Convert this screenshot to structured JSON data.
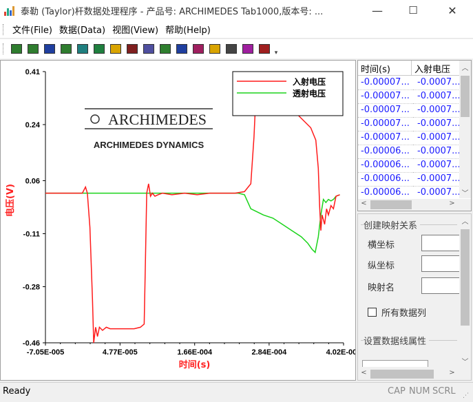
{
  "window": {
    "title": "泰勒 (Taylor)杆数据处理程序 - 产品号: ARCHIMEDES Tab1000,版本号: ...",
    "minimize": "—",
    "maximize": "☐",
    "close": "✕"
  },
  "menu": [
    {
      "label": "文件(File)"
    },
    {
      "label": "数据(Data)"
    },
    {
      "label": "视图(View)"
    },
    {
      "label": "帮助(Help)"
    }
  ],
  "toolbar": {
    "buttons": [
      {
        "icon": "open-folder-icon",
        "color": "#2f7d2f"
      },
      {
        "icon": "open-file-icon",
        "color": "#2f7d2f"
      },
      {
        "icon": "save-icon",
        "color": "#1f3f9f"
      },
      {
        "icon": "print-icon",
        "color": "#2f7d2f"
      },
      {
        "icon": "chart-icon",
        "color": "#1f7f7f"
      },
      {
        "icon": "wave-icon",
        "color": "#1f7f3f"
      },
      {
        "icon": "table-icon",
        "color": "#d9a400"
      },
      {
        "icon": "zoom-icon",
        "color": "#7f1f1f"
      },
      {
        "icon": "transform-icon",
        "color": "#4f4f9f"
      },
      {
        "icon": "refresh-icon",
        "color": "#2f7f2f"
      },
      {
        "icon": "grid-icon",
        "color": "#1f3f9f"
      },
      {
        "icon": "close-box-icon",
        "color": "#9f1f5f"
      },
      {
        "icon": "help-icon",
        "color": "#d9a400"
      },
      {
        "icon": "notes-icon",
        "color": "#444444"
      },
      {
        "icon": "cross-icon",
        "color": "#9f1f9f"
      },
      {
        "icon": "axis-icon",
        "color": "#9f1f1f"
      }
    ],
    "more": "▾"
  },
  "logo": {
    "brand": "ARCHIMEDES",
    "tagline": "ARCHIMEDES DYNAMICS"
  },
  "chart_data": {
    "type": "line",
    "xlabel": "时间(s)",
    "ylabel": "电压(V)",
    "x_ticks": [
      "-7.05E-005",
      "4.77E-005",
      "1.66E-004",
      "2.84E-004",
      "4.02E-004"
    ],
    "y_ticks": [
      "0.41",
      "0.24",
      "0.06",
      "-0.11",
      "-0.28",
      "-0.46"
    ],
    "xlim": [
      -7.05e-05,
      0.000402
    ],
    "ylim": [
      -0.46,
      0.41
    ],
    "grid": false,
    "legend": "top-right",
    "series": [
      {
        "name": "入射电压",
        "color": "#ff1a1a",
        "x": [
          -7.05e-05,
          -1.2e-05,
          -7e-06,
          -4e-06,
          0,
          4e-06,
          6e-06,
          9e-06,
          1.2e-05,
          1.5e-05,
          2e-05,
          2.6e-05,
          3.2e-05,
          4e-05,
          5e-05,
          6e-05,
          7e-05,
          8e-05,
          8.6e-05,
          8.8e-05,
          9e-05,
          9.3e-05,
          9.6e-05,
          9.9e-05,
          0.000103,
          0.000108,
          0.000115,
          0.00013,
          0.00015,
          0.00017,
          0.00019,
          0.00021,
          0.00023,
          0.000245,
          0.000255,
          0.00026,
          0.000263,
          0.000266,
          0.000269,
          0.000273,
          0.000276,
          0.000279,
          0.000282,
          0.000286,
          0.000289,
          0.000292,
          0.000296,
          0.0003,
          0.000305,
          0.00031,
          0.00032,
          0.000335,
          0.00035,
          0.000358,
          0.000362,
          0.000364,
          0.000366,
          0.000368,
          0.000372,
          0.000375,
          0.000378,
          0.000382,
          0.000386,
          0.00039,
          0.000396
        ],
        "y": [
          0.02,
          0.02,
          0.04,
          0.02,
          -0.09,
          -0.32,
          -0.46,
          -0.41,
          -0.44,
          -0.41,
          -0.42,
          -0.41,
          -0.415,
          -0.415,
          -0.415,
          -0.415,
          -0.415,
          -0.41,
          -0.4,
          -0.2,
          0.02,
          0.05,
          0.01,
          0.02,
          0.01,
          0.015,
          0.02,
          0.015,
          0.02,
          0.015,
          0.02,
          0.02,
          0.02,
          0.025,
          0.05,
          0.2,
          0.33,
          0.41,
          0.38,
          0.36,
          0.4,
          0.33,
          0.39,
          0.33,
          0.36,
          0.33,
          0.35,
          0.335,
          0.32,
          0.31,
          0.29,
          0.26,
          0.23,
          0.19,
          0.1,
          -0.02,
          -0.1,
          -0.05,
          -0.08,
          -0.03,
          -0.05,
          -0.02,
          -0.03,
          0.01,
          0.015
        ]
      },
      {
        "name": "透射电压",
        "color": "#1ad41a",
        "x": [
          -7.05e-05,
          0,
          5e-05,
          0.0001,
          0.00015,
          0.0002,
          0.000235,
          0.000245,
          0.000255,
          0.000265,
          0.000275,
          0.00029,
          0.000305,
          0.00032,
          0.000335,
          0.000345,
          0.000352,
          0.000357,
          0.000362,
          0.000366,
          0.00037,
          0.000374,
          0.000378,
          0.000382,
          0.000386,
          0.00039,
          0.000396
        ],
        "y": [
          0.02,
          0.02,
          0.02,
          0.02,
          0.02,
          0.02,
          0.02,
          0.015,
          -0.03,
          -0.04,
          -0.05,
          -0.06,
          -0.08,
          -0.1,
          -0.12,
          -0.14,
          -0.16,
          -0.17,
          -0.12,
          -0.05,
          0.0,
          -0.01,
          0.0,
          -0.005,
          0.0,
          0.01,
          0.015
        ]
      }
    ]
  },
  "grid": {
    "columns": [
      "时间(s)",
      "入射电压"
    ],
    "rows": [
      [
        "-0.00007...",
        "-0.0007..."
      ],
      [
        "-0.00007...",
        "-0.0007..."
      ],
      [
        "-0.00007...",
        "-0.0007..."
      ],
      [
        "-0.00007...",
        "-0.0007..."
      ],
      [
        "-0.00007...",
        "-0.0007..."
      ],
      [
        "-0.00006...",
        "-0.0007..."
      ],
      [
        "-0.00006...",
        "-0.0007..."
      ],
      [
        "-0.00006...",
        "-0.0007..."
      ],
      [
        "-0.00006...",
        "-0.0007..."
      ]
    ]
  },
  "mapping": {
    "group_title": "创建映射关系",
    "x_label": "横坐标",
    "y_label": "纵坐标",
    "name_label": "映射名",
    "all_columns": "所有数据列",
    "line_group_title": "设置数据线属性"
  },
  "status": {
    "text": "Ready",
    "cap": "CAP",
    "num": "NUM",
    "scrl": "SCRL"
  }
}
